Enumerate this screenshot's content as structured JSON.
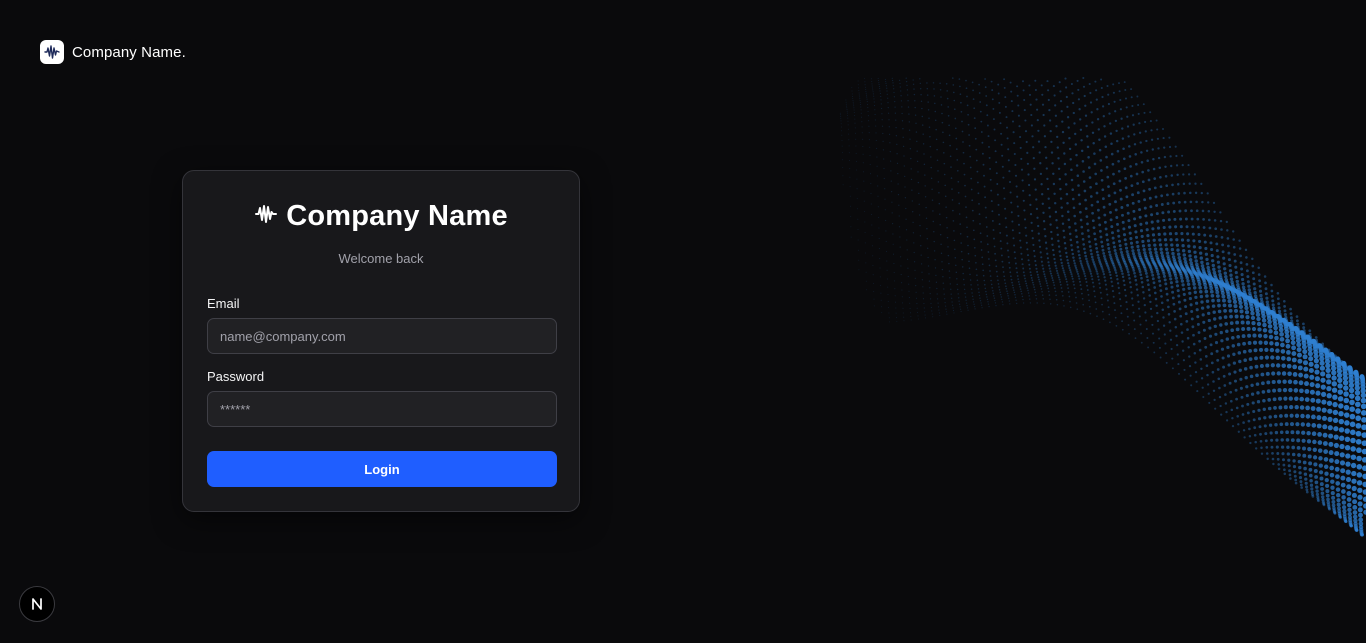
{
  "header": {
    "brand_name": "Company Name.",
    "logo_icon": "waveform-icon"
  },
  "login_card": {
    "title": "Company Name",
    "title_icon": "waveform-icon",
    "subtitle": "Welcome back",
    "email": {
      "label": "Email",
      "placeholder": "name@company.com",
      "value": ""
    },
    "password": {
      "label": "Password",
      "placeholder": "******",
      "value": ""
    },
    "submit_label": "Login"
  },
  "dev_indicator": {
    "label": "N",
    "icon": "nextjs-icon"
  },
  "colors": {
    "background": "#0a0a0c",
    "card": "#18181b",
    "accent": "#1f5eff",
    "dots": "#2f7fd0"
  }
}
